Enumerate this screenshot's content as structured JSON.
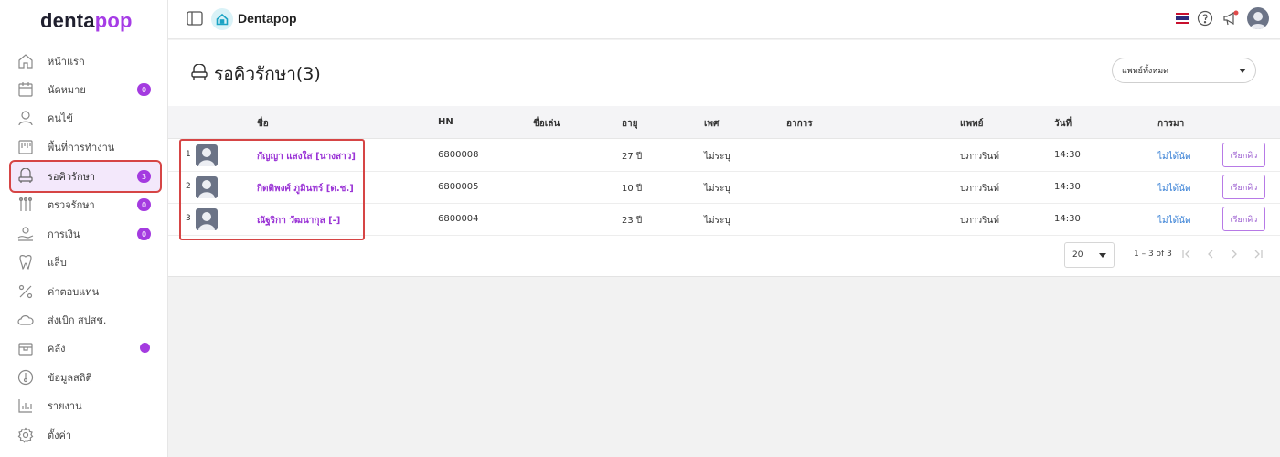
{
  "logo": {
    "part1": "denta",
    "part2": "pop"
  },
  "sidebar": {
    "items": [
      {
        "label": "หน้าแรก",
        "icon": "home-icon"
      },
      {
        "label": "นัดหมาย",
        "icon": "calendar-icon",
        "badge": "0"
      },
      {
        "label": "คนไข้",
        "icon": "person-icon"
      },
      {
        "label": "พื้นที่การทำงาน",
        "icon": "workspace-icon"
      },
      {
        "label": "รอคิวรักษา",
        "icon": "dental-chair-icon",
        "badge": "3",
        "active": true
      },
      {
        "label": "ตรวจรักษา",
        "icon": "dental-tools-icon",
        "badge": "0"
      },
      {
        "label": "การเงิน",
        "icon": "payment-icon",
        "badge": "0"
      },
      {
        "label": "แล็บ",
        "icon": "tooth-icon"
      },
      {
        "label": "ค่าตอบแทน",
        "icon": "percent-icon"
      },
      {
        "label": "ส่งเบิก สปสช.",
        "icon": "cloud-icon"
      },
      {
        "label": "คลัง",
        "icon": "box-icon",
        "dot": true
      },
      {
        "label": "ข้อมูลสถิติ",
        "icon": "thermometer-icon"
      },
      {
        "label": "รายงาน",
        "icon": "report-chart-icon"
      },
      {
        "label": "ตั้งค่า",
        "icon": "gear-icon"
      }
    ]
  },
  "topbar": {
    "title": "Dentapop"
  },
  "page": {
    "title": "รอคิวรักษา(3)",
    "doctor_filter": "แพทย์ทั้งหมด"
  },
  "table": {
    "headers": {
      "name": "ชื่อ",
      "hn": "HN",
      "nickname": "ชื่อเล่น",
      "age": "อายุ",
      "sex": "เพศ",
      "symptom": "อาการ",
      "doctor": "แพทย์",
      "date": "วันที่",
      "arrival": "การมา"
    },
    "rows": [
      {
        "num": "1",
        "name": "กัญญา แสงใส [นางสาว]",
        "hn": "6800008",
        "nickname": "",
        "age": "27 ปี",
        "sex": "ไม่ระบุ",
        "symptom": "",
        "doctor": "ปภาวรินท์",
        "date": "14:30",
        "arrival": "ไม่ได้นัด",
        "action": "เรียกคิว"
      },
      {
        "num": "2",
        "name": "กิตติพงศ์ ภูมินทร์ [ด.ช.]",
        "hn": "6800005",
        "nickname": "",
        "age": "10 ปี",
        "sex": "ไม่ระบุ",
        "symptom": "",
        "doctor": "ปภาวรินท์",
        "date": "14:30",
        "arrival": "ไม่ได้นัด",
        "action": "เรียกคิว"
      },
      {
        "num": "3",
        "name": "ณัฐริกา วัฒนากุล [-]",
        "hn": "6800004",
        "nickname": "",
        "age": "23 ปี",
        "sex": "ไม่ระบุ",
        "symptom": "",
        "doctor": "ปภาวรินท์",
        "date": "14:30",
        "arrival": "ไม่ได้นัด",
        "action": "เรียกคิว"
      }
    ]
  },
  "pagination": {
    "page_size": "20",
    "range": "1 – 3 of 3"
  },
  "colors": {
    "brand": "#a63ce6",
    "badge": "#a43be0",
    "highlight": "#d64545",
    "link": "#3b82d6"
  }
}
